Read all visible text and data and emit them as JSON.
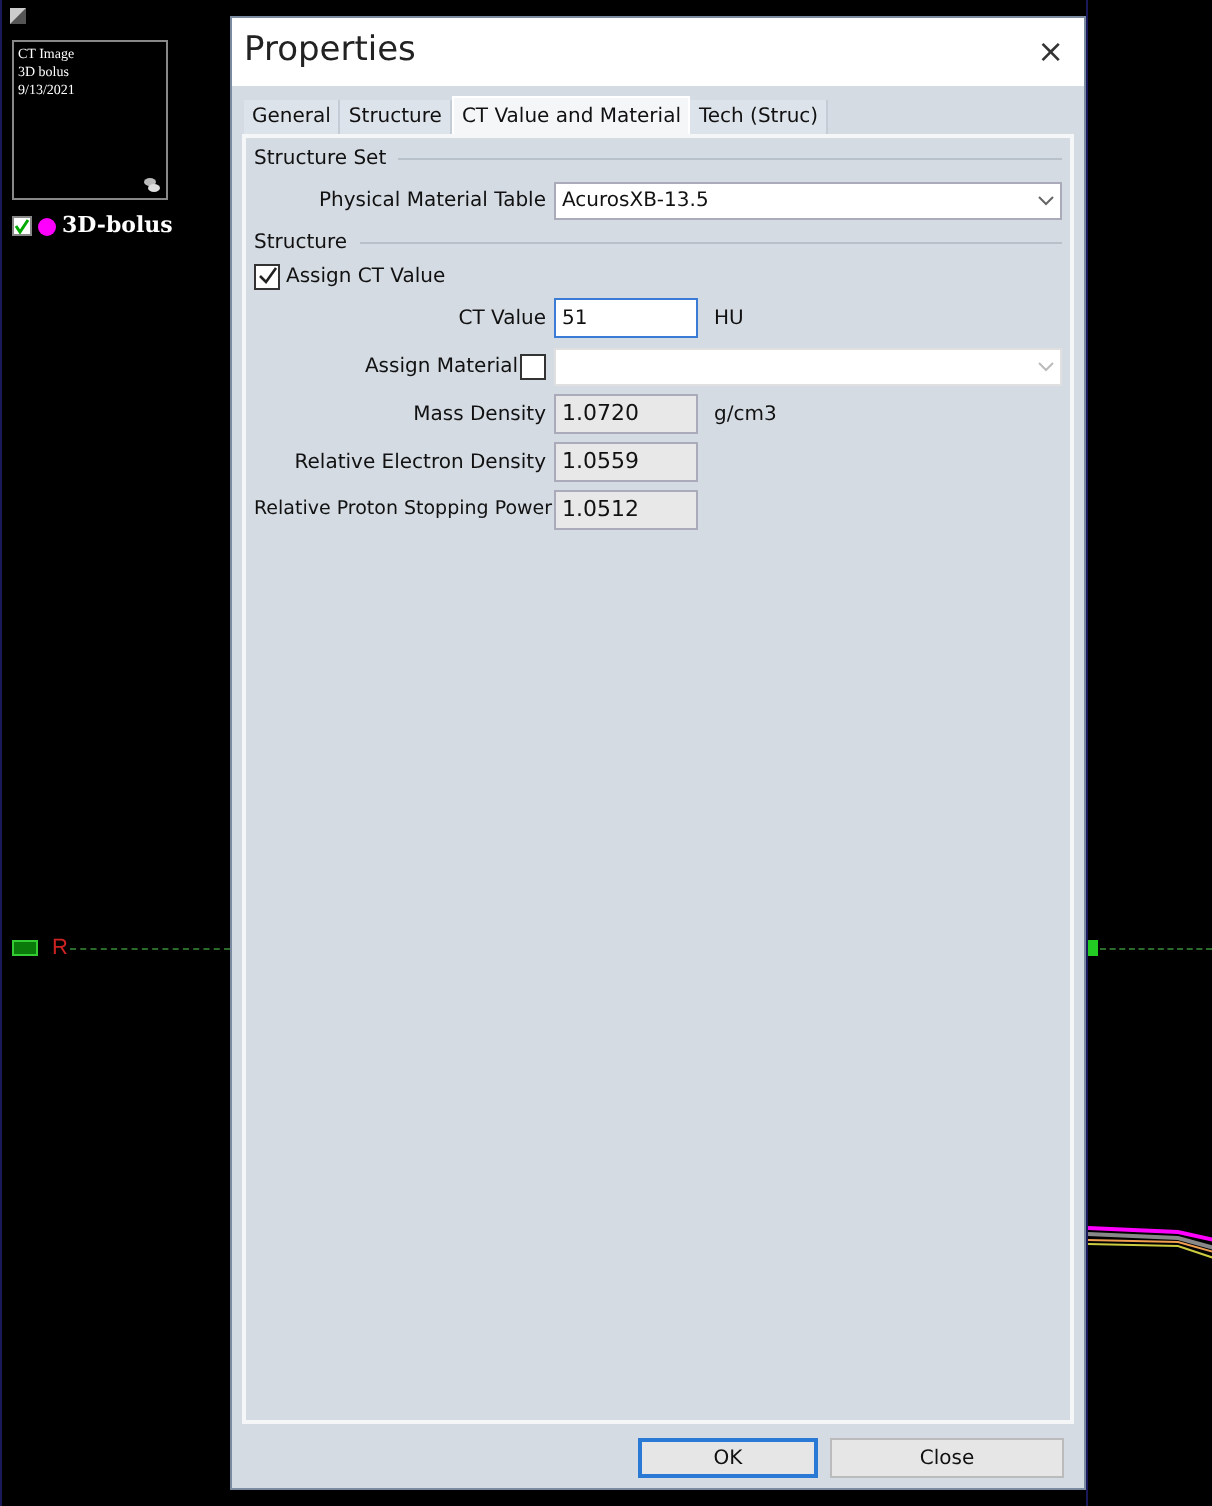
{
  "viewer": {
    "thumbnail": {
      "lines": [
        "CT Image",
        "3D bolus",
        "9/13/2021"
      ]
    },
    "structure": {
      "name": "3D-bolus",
      "visible": true,
      "color": "#ff00ff"
    },
    "orientation_label": "R"
  },
  "dialog": {
    "title": "Properties",
    "close": "×",
    "tabs": [
      {
        "label": "General",
        "selected": false
      },
      {
        "label": "Structure",
        "selected": false
      },
      {
        "label": "CT Value and Material",
        "selected": true
      },
      {
        "label": "Tech (Struc)",
        "selected": false
      }
    ],
    "structure_set": {
      "heading": "Structure Set",
      "physical_material_table": {
        "label": "Physical Material Table",
        "value": "AcurosXB-13.5"
      }
    },
    "structure": {
      "heading": "Structure",
      "assign_ct_value": {
        "label": "Assign CT Value",
        "checked": true
      },
      "ct_value": {
        "label": "CT Value",
        "value": "51",
        "unit": "HU"
      },
      "assign_material": {
        "label": "Assign Material",
        "checked": false
      },
      "mass_density": {
        "label": "Mass Density",
        "value": "1.0720",
        "unit": "g/cm3"
      },
      "relative_electron_density": {
        "label": "Relative Electron Density",
        "value": "1.0559"
      },
      "relative_proton_stopping_power": {
        "label": "Relative Proton Stopping Power",
        "value": "1.0512"
      }
    },
    "buttons": [
      {
        "label": "OK",
        "default": true
      },
      {
        "label": "Close",
        "default": false
      }
    ]
  }
}
